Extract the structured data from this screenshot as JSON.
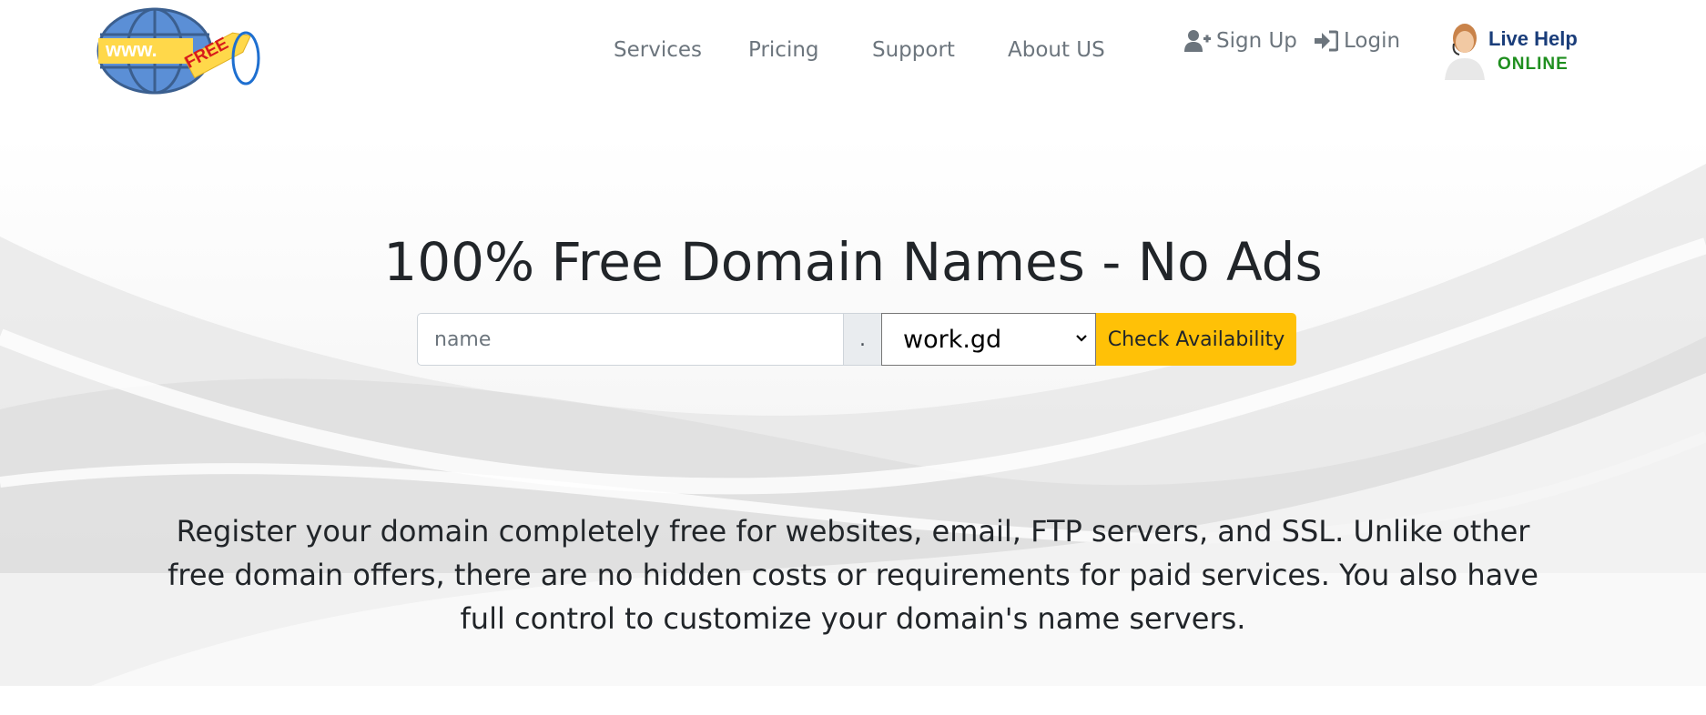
{
  "header": {
    "logo": {
      "www_text": "www.",
      "tag_text": "FREE"
    },
    "nav": [
      {
        "label": "Services"
      },
      {
        "label": "Pricing"
      },
      {
        "label": "Support"
      },
      {
        "label": "About US"
      }
    ],
    "account": {
      "signup_label": "Sign Up",
      "login_label": "Login"
    },
    "live_help": {
      "line1": "Live Help",
      "line2": "ONLINE"
    }
  },
  "hero": {
    "title": "100% Free Domain Names - No Ads",
    "search": {
      "placeholder": "name",
      "value": "",
      "separator": ".",
      "tld_selected": "work.gd",
      "button_label": "Check Availability"
    },
    "description": "Register your domain completely free for websites, email, FTP servers, and SSL. Unlike other free domain offers, there are no hidden costs or requirements for paid services. You also have full control to customize your domain's name servers."
  },
  "colors": {
    "accent_button": "#ffc107",
    "nav_text": "#6c757d",
    "heading_text": "#212529",
    "live_help_blue": "#1a3d7a",
    "online_green": "#1f8f1f"
  },
  "icons": {
    "signup": "user-plus-icon",
    "login": "sign-in-icon",
    "select": "chevron-down-icon"
  }
}
